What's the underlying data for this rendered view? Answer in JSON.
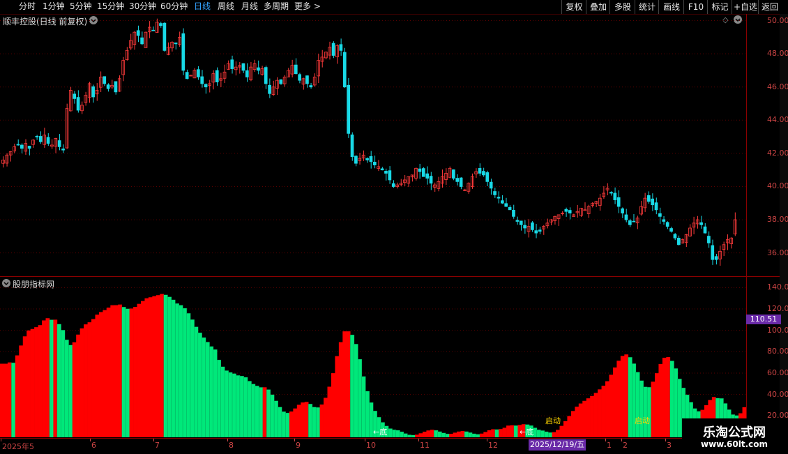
{
  "toolbar": {
    "periods": [
      "分时",
      "1分钟",
      "5分钟",
      "15分钟",
      "30分钟",
      "60分钟",
      "日线",
      "周线",
      "月线",
      "多周期",
      "更多 >"
    ],
    "active_index": 6,
    "right_buttons": [
      "复权",
      "叠加",
      "多股",
      "统计",
      "画线",
      "F10",
      "标记",
      "+自选",
      "返回"
    ]
  },
  "price_panel": {
    "title": "顺丰控股(日线 前复权)",
    "ylabels": [
      "50.00",
      "48.00",
      "46.00",
      "44.00",
      "42.00",
      "40.00",
      "38.00",
      "36.00"
    ],
    "ymin": 34.6,
    "ymax": 50.4
  },
  "indicator_panel": {
    "title": "股朋指标网",
    "ylabels": [
      "140.0",
      "120.0",
      "100.0",
      "80.00",
      "60.00",
      "40.00",
      "20.00"
    ],
    "highlight_value": "110.51",
    "ymin": 0,
    "ymax": 150,
    "annotations": [
      {
        "text": "←底",
        "index": 0
      },
      {
        "text": "←底",
        "index": 1
      },
      {
        "text": "启动",
        "index": 2
      },
      {
        "text": "启动",
        "index": 3
      }
    ]
  },
  "date_axis": {
    "labels": [
      "2025年5",
      "6",
      "7",
      "8",
      "9",
      "10",
      "11",
      "12",
      "1",
      "2",
      "3"
    ],
    "cursor_label": "2025/12/19/五"
  },
  "watermark": {
    "title": "乐淘公式网",
    "url": "www.60lt.com"
  },
  "colors": {
    "up": "#ff3b3b",
    "down": "#19d9e6",
    "ind_red": "#ff0000",
    "ind_green": "#00e87a",
    "grid": "#5a0000",
    "highlight_bg": "#6a2aa8"
  },
  "chart_data": {
    "type": "candlestick",
    "close": [
      41.6,
      41.9,
      42.1,
      42.4,
      42.5,
      42.3,
      42.6,
      42.3,
      42.8,
      43.0,
      42.7,
      43.1,
      42.6,
      42.5,
      42.9,
      42.4,
      42.2,
      44.7,
      45.8,
      45.3,
      44.6,
      44.9,
      45.5,
      46.2,
      45.4,
      45.8,
      46.6,
      46.2,
      45.9,
      46.1,
      45.7,
      46.5,
      47.6,
      48.2,
      48.8,
      49.3,
      49.1,
      48.6,
      49.3,
      49.6,
      49.4,
      49.9,
      49.7,
      48.2,
      48.4,
      48.7,
      48.6,
      49.0,
      47.0,
      46.5,
      46.7,
      47.0,
      46.6,
      46.2,
      46.0,
      46.2,
      46.8,
      46.3,
      46.5,
      46.9,
      47.4,
      47.1,
      47.2,
      47.3,
      47.0,
      46.6,
      47.2,
      47.4,
      47.0,
      47.1,
      46.2,
      45.6,
      46.0,
      46.4,
      46.2,
      46.6,
      47.0,
      47.3,
      46.8,
      46.4,
      46.5,
      46.2,
      46.0,
      46.6,
      47.6,
      47.8,
      48.1,
      48.4,
      47.9,
      48.5,
      48.2,
      46.0,
      43.2,
      41.8,
      41.4,
      41.7,
      41.9,
      41.6,
      41.5,
      41.3,
      41.2,
      41.0,
      40.8,
      40.4,
      40.0,
      40.1,
      40.2,
      40.4,
      40.6,
      40.7,
      41.1,
      40.9,
      40.6,
      40.5,
      40.2,
      40.1,
      40.3,
      40.6,
      40.8,
      41.1,
      40.5,
      40.3,
      40.0,
      39.8,
      40.2,
      40.6,
      40.9,
      40.8,
      40.7,
      40.3,
      39.9,
      39.5,
      39.3,
      39.0,
      38.8,
      38.6,
      38.2,
      37.9,
      37.7,
      37.5,
      37.6,
      37.4,
      37.2,
      37.3,
      37.6,
      37.8,
      38.0,
      38.2,
      38.3,
      38.4,
      38.5,
      38.4,
      38.3,
      38.5,
      38.7,
      38.6,
      38.8,
      39.0,
      39.1,
      39.3,
      39.6,
      39.9,
      39.6,
      39.2,
      38.8,
      38.4,
      38.0,
      37.7,
      37.9,
      38.1,
      38.8,
      39.3,
      39.1,
      38.9,
      38.6,
      38.2,
      37.9,
      37.6,
      37.3,
      36.9,
      36.5,
      36.8,
      37.1,
      37.5,
      37.8,
      38.0,
      37.7,
      37.2,
      36.6,
      35.6,
      35.6,
      36.1,
      36.5,
      36.8,
      36.9,
      38.0
    ]
  }
}
